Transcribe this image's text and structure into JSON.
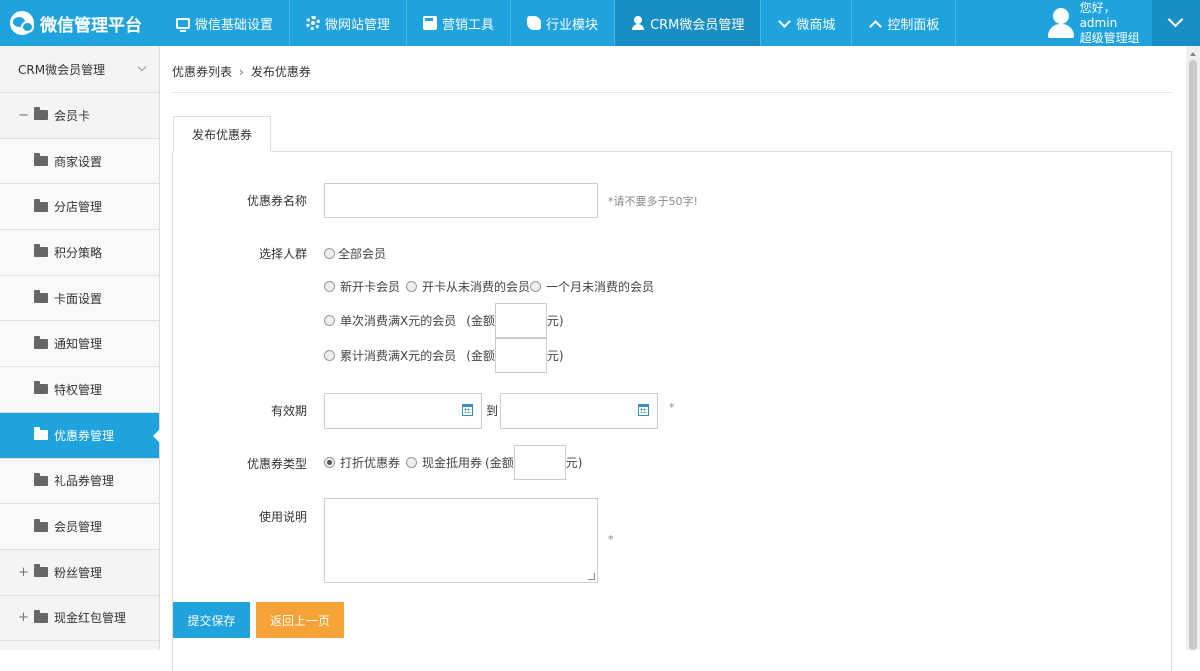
{
  "app": {
    "title": "微信管理平台"
  },
  "nav": {
    "items": [
      {
        "label": "微信基础设置",
        "icon": "monitor-icon"
      },
      {
        "label": "微网站管理",
        "icon": "gear-icon"
      },
      {
        "label": "营销工具",
        "icon": "calculator-icon"
      },
      {
        "label": "行业模块",
        "icon": "puzzle-icon"
      },
      {
        "label": "CRM微会员管理",
        "icon": "user-icon",
        "active": true
      },
      {
        "label": "微商城",
        "icon": "chevron-down-icon"
      },
      {
        "label": "控制面板",
        "icon": "chevron-up-icon"
      }
    ]
  },
  "user": {
    "greeting": "您好，admin",
    "role": "超级管理组"
  },
  "sidebar": {
    "header": "CRM微会员管理",
    "items": [
      {
        "label": "会员卡",
        "sign": "−",
        "group": true
      },
      {
        "label": "商家设置"
      },
      {
        "label": "分店管理"
      },
      {
        "label": "积分策略"
      },
      {
        "label": "卡面设置"
      },
      {
        "label": "通知管理"
      },
      {
        "label": "特权管理"
      },
      {
        "label": "优惠券管理",
        "active": true
      },
      {
        "label": "礼品券管理"
      },
      {
        "label": "会员管理"
      },
      {
        "label": "粉丝管理",
        "sign": "+",
        "group": true
      },
      {
        "label": "现金红包管理",
        "sign": "+",
        "group": true
      }
    ]
  },
  "breadcrumb": {
    "parent": "优惠券列表",
    "separator": "›",
    "current": "发布优惠券"
  },
  "tab": {
    "label": "发布优惠券"
  },
  "form": {
    "name": {
      "label": "优惠券名称",
      "value": "",
      "hint": "*请不要多于50字!"
    },
    "audience": {
      "label": "选择人群",
      "all": "全部会员",
      "new_card": "新开卡会员",
      "never_spent": "开卡从未消费的会员",
      "month_no_spend": "一个月未消费的会员",
      "single_spend": "单次消费满X元的会员",
      "cumulative_spend": "累计消费满X元的会员",
      "amount_prefix": "(金额",
      "amount_suffix": "元)"
    },
    "validity": {
      "label": "有效期",
      "to": "到",
      "required": "*"
    },
    "type": {
      "label": "优惠券类型",
      "discount": "打折优惠券",
      "cash": "现金抵用券",
      "amount_prefix": "(金额",
      "amount_suffix": "元)"
    },
    "instructions": {
      "label": "使用说明",
      "required": "*"
    }
  },
  "buttons": {
    "submit": "提交保存",
    "back": "返回上一页"
  }
}
